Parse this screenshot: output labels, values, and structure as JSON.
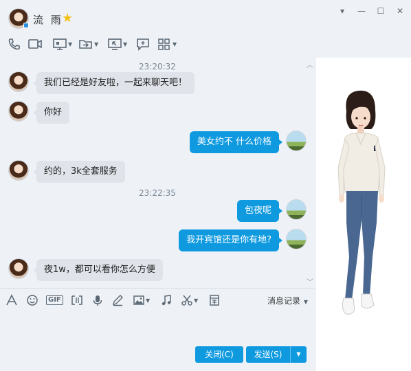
{
  "header": {
    "contact_name": "流 雨",
    "window_buttons": [
      "▾",
      "—",
      "☐",
      "✕"
    ]
  },
  "toolbar": {
    "icons": [
      "phone-icon",
      "video-icon",
      "screen-share-icon",
      "file-transfer-icon",
      "remote-desktop-icon",
      "note-icon",
      "apps-icon"
    ]
  },
  "messages": [
    {
      "type": "time",
      "text": "23:20:32"
    },
    {
      "type": "msg",
      "side": "left",
      "text": "我们已经是好友啦，一起来聊天吧！"
    },
    {
      "type": "msg",
      "side": "left",
      "text": "你好"
    },
    {
      "type": "msg",
      "side": "right",
      "text": "美女约不  什么价格"
    },
    {
      "type": "msg",
      "side": "left",
      "text": "约的，3k全套服务"
    },
    {
      "type": "time",
      "text": "23:22:35"
    },
    {
      "type": "msg",
      "side": "right",
      "text": "包夜呢"
    },
    {
      "type": "msg",
      "side": "right",
      "text": "我开宾馆还是你有地?"
    },
    {
      "type": "msg",
      "side": "left",
      "text": "夜1w，都可以看你怎么方便"
    }
  ],
  "input_toolbar": {
    "gif_label": "GIF",
    "history_label": "消息记录"
  },
  "buttons": {
    "close": "关闭(C)",
    "send": "发送(S)"
  },
  "colors": {
    "accent": "#0f9ae0",
    "background": "#eef2f7",
    "left_bubble": "#e0e4ea"
  }
}
